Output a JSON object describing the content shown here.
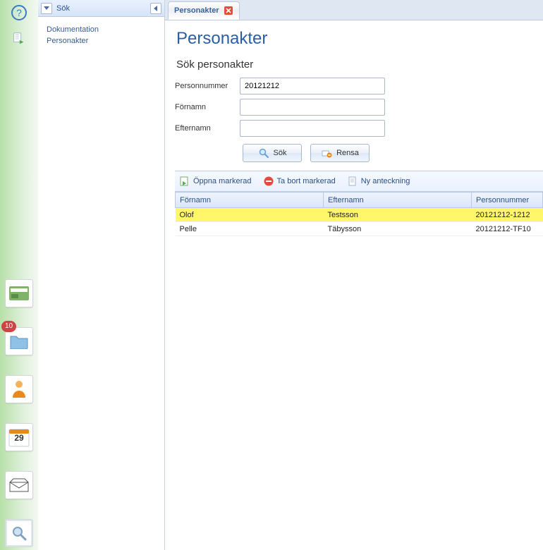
{
  "rail": {
    "badge": "10",
    "calendar_day": "29"
  },
  "sidebar": {
    "title": "Sök",
    "items": [
      {
        "label": "Dokumentation"
      },
      {
        "label": "Personakter"
      }
    ]
  },
  "tab": {
    "title": "Personakter"
  },
  "page": {
    "title": "Personakter",
    "subtitle": "Sök personakter",
    "labels": {
      "personnummer": "Personnummer",
      "fornamn": "Förnamn",
      "efternamn": "Efternamn"
    },
    "values": {
      "personnummer": "20121212",
      "fornamn": "",
      "efternamn": ""
    },
    "buttons": {
      "search": "Sök",
      "clear": "Rensa"
    }
  },
  "toolbar": {
    "open": "Öppna markerad",
    "delete": "Ta bort markerad",
    "note": "Ny anteckning"
  },
  "table": {
    "headers": {
      "fornamn": "Förnamn",
      "efternamn": "Efternamn",
      "personnummer": "Personnummer"
    },
    "rows": [
      {
        "fornamn": "Olof",
        "efternamn": "Testsson",
        "personnummer": "20121212-1212",
        "selected": true
      },
      {
        "fornamn": "Pelle",
        "efternamn": "Täbysson",
        "personnummer": "20121212-TF10",
        "selected": false
      }
    ]
  }
}
